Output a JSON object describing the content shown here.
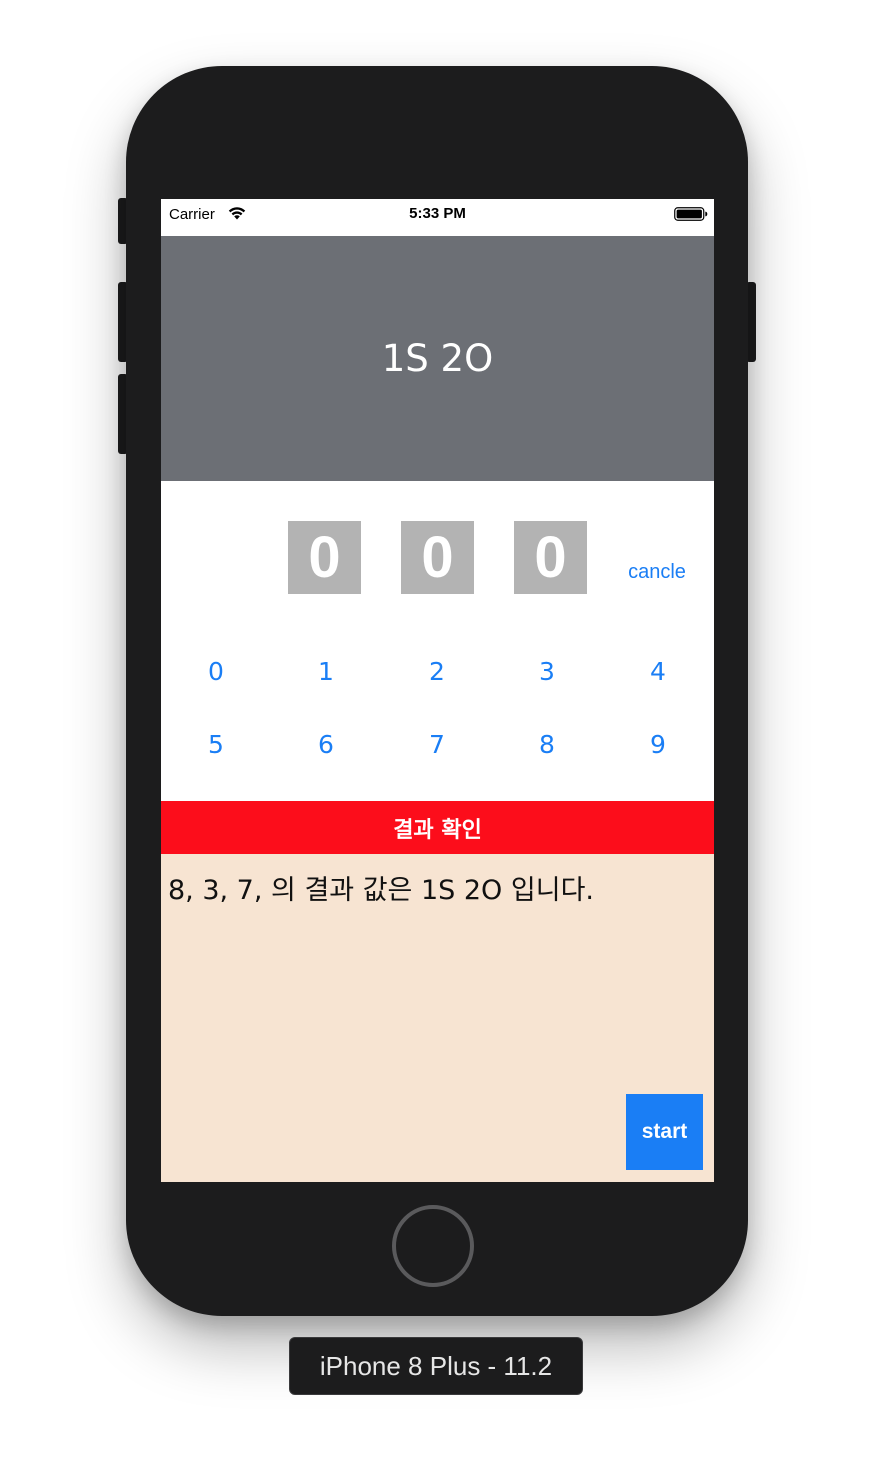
{
  "status_bar": {
    "carrier": "Carrier",
    "time": "5:33 PM",
    "wifi_icon": "wifi-icon",
    "battery_icon": "battery-full-icon"
  },
  "header": {
    "result": "1S 2O"
  },
  "digits": [
    "0",
    "0",
    "0"
  ],
  "cancel_label": "cancle",
  "keypad": {
    "row1": [
      "0",
      "1",
      "2",
      "3",
      "4"
    ],
    "row2": [
      "5",
      "6",
      "7",
      "8",
      "9"
    ]
  },
  "check_button_label": "결과 확인",
  "log": {
    "text": "8, 3, 7, 의 결과 값은 1S 2O 입니다."
  },
  "start_label": "start",
  "device_label": "iPhone 8 Plus - 11.2",
  "colors": {
    "header_bg": "#6c6f75",
    "accent_blue": "#1a7ef5",
    "check_red": "#fc0d1b",
    "log_bg": "#f7e4d2",
    "digit_bg": "#b3b3b3"
  }
}
